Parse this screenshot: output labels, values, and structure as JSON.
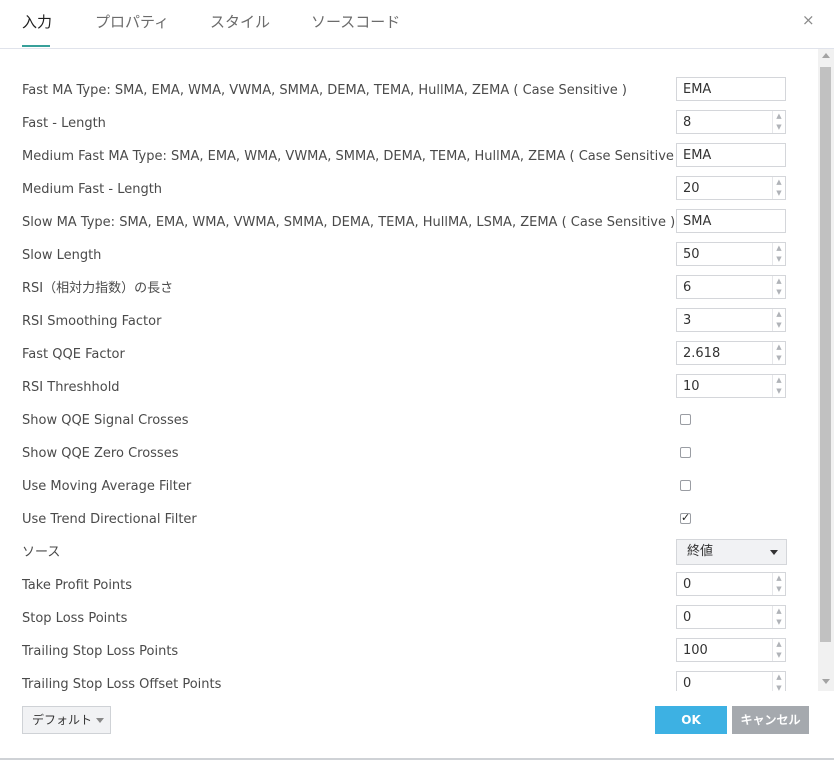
{
  "tabs": [
    {
      "label": "入力",
      "active": true
    },
    {
      "label": "プロパティ",
      "active": false
    },
    {
      "label": "スタイル",
      "active": false
    },
    {
      "label": "ソースコード",
      "active": false
    }
  ],
  "close_label": "×",
  "spin_up": "▲",
  "spin_down": "▼",
  "check_mark": "✓",
  "rows": [
    {
      "label": "Fast MA Type: SMA, EMA, WMA, VWMA, SMMA, DEMA, TEMA, HullMA, ZEMA ( Case Sensitive )",
      "type": "text",
      "value": "EMA"
    },
    {
      "label": "Fast - Length",
      "type": "number",
      "value": "8"
    },
    {
      "label": "Medium Fast MA Type: SMA, EMA, WMA, VWMA, SMMA, DEMA, TEMA, HullMA, ZEMA ( Case Sensitive )",
      "type": "text",
      "value": "EMA"
    },
    {
      "label": "Medium Fast - Length",
      "type": "number",
      "value": "20"
    },
    {
      "label": "Slow MA Type: SMA, EMA, WMA, VWMA, SMMA, DEMA, TEMA, HullMA, LSMA, ZEMA ( Case Sensitive )",
      "type": "text",
      "value": "SMA"
    },
    {
      "label": "Slow Length",
      "type": "number",
      "value": "50"
    },
    {
      "label": "RSI（相対力指数）の長さ",
      "type": "number",
      "value": "6"
    },
    {
      "label": "RSI Smoothing Factor",
      "type": "number",
      "value": "3"
    },
    {
      "label": "Fast QQE Factor",
      "type": "number",
      "value": "2.618"
    },
    {
      "label": "RSI Threshhold",
      "type": "number",
      "value": "10"
    },
    {
      "label": "Show QQE Signal Crosses",
      "type": "checkbox",
      "checked": false
    },
    {
      "label": "Show QQE Zero Crosses",
      "type": "checkbox",
      "checked": false
    },
    {
      "label": "Use Moving Average Filter",
      "type": "checkbox",
      "checked": false
    },
    {
      "label": "Use Trend Directional Filter",
      "type": "checkbox",
      "checked": true
    },
    {
      "label": "ソース",
      "type": "select",
      "value": "終値"
    },
    {
      "label": "Take Profit Points",
      "type": "number",
      "value": "0"
    },
    {
      "label": "Stop Loss Points",
      "type": "number",
      "value": "0"
    },
    {
      "label": "Trailing Stop Loss Points",
      "type": "number",
      "value": "100"
    },
    {
      "label": "Trailing Stop Loss Offset Points",
      "type": "number",
      "value": "0"
    }
  ],
  "footer": {
    "defaults_label": "デフォルト",
    "ok_label": "OK",
    "cancel_label": "キャンセル"
  },
  "colors": {
    "accent": "#37a09a",
    "ok_button": "#3db1e3",
    "cancel_button": "#a5a9ae"
  }
}
